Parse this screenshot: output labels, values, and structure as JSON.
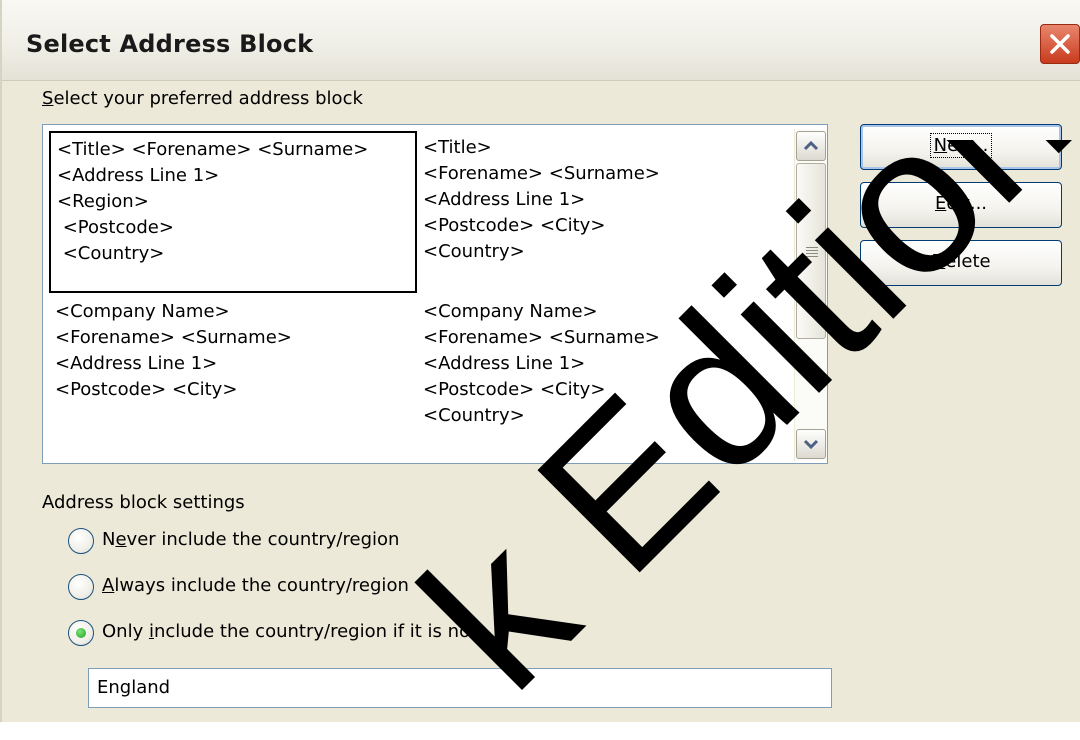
{
  "window": {
    "title": "Select Address Block"
  },
  "list": {
    "label_prefix": "S",
    "label_rest": "elect your preferred address block",
    "blocks": [
      {
        "text": "<Title> <Forename> <Surname>\n<Address Line 1>\n<Region>\n <Postcode>\n <Country>",
        "selected": true
      },
      {
        "text": "<Title>\n<Forename> <Surname>\n<Address Line 1>\n<Postcode> <City>\n<Country>",
        "selected": false
      },
      {
        "text": "<Company Name>\n<Forename> <Surname>\n<Address Line 1>\n<Postcode> <City>",
        "selected": false
      },
      {
        "text": "<Company Name>\n<Forename> <Surname>\n<Address Line 1>\n<Postcode> <City>\n<Country>",
        "selected": false
      }
    ]
  },
  "buttons": {
    "new": {
      "mnemonic": "N",
      "rest": "ew..."
    },
    "edit": {
      "mnemonic": "E",
      "rest": "dit..."
    },
    "delete": {
      "mnemonic": "D",
      "rest": "elete"
    }
  },
  "settings": {
    "heading": "Address block settings",
    "options": [
      {
        "pre": "N",
        "mnemonic": "e",
        "rest": "ver include the country/region",
        "checked": false
      },
      {
        "pre": "",
        "mnemonic": "A",
        "rest": "lways include the country/region",
        "checked": false
      },
      {
        "pre": "Only ",
        "mnemonic": "i",
        "rest": "nclude the country/region if it is not:",
        "checked": true
      }
    ],
    "country_value": "England"
  },
  "watermark": {
    "text": "k Edition"
  },
  "colors": {
    "accent": "#003c74",
    "close": "#c93b1d",
    "radio_dot": "#21a121"
  }
}
